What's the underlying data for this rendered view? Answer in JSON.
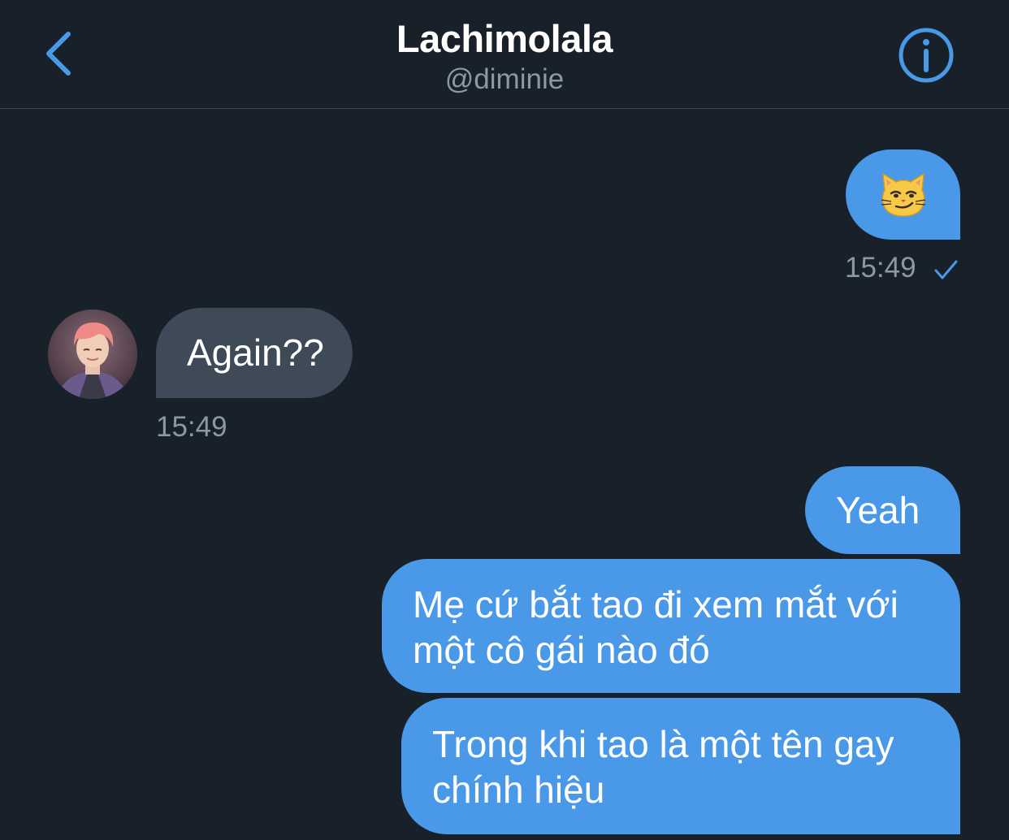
{
  "header": {
    "title": "Lachimolala",
    "handle": "@diminie",
    "back_icon": "chevron-left-icon",
    "info_icon": "info-circle-icon"
  },
  "messages": [
    {
      "from": "me",
      "type": "emoji",
      "emoji": "smirking-cat",
      "time": "15:49",
      "status": "sent-check"
    },
    {
      "from": "them",
      "text": "Again??",
      "time": "15:49"
    },
    {
      "from": "me",
      "text": "Yeah"
    },
    {
      "from": "me",
      "lines": [
        "Mẹ cứ bắt tao đi xem mắt với",
        "một cô gái nào đó"
      ]
    },
    {
      "from": "me",
      "lines": [
        "Trong khi tao là một tên gay",
        "chính hiệu"
      ]
    }
  ],
  "colors": {
    "background": "#182029",
    "accent": "#4a99e9",
    "incoming_bubble": "#3e4a57",
    "muted_text": "#8b98a5"
  }
}
